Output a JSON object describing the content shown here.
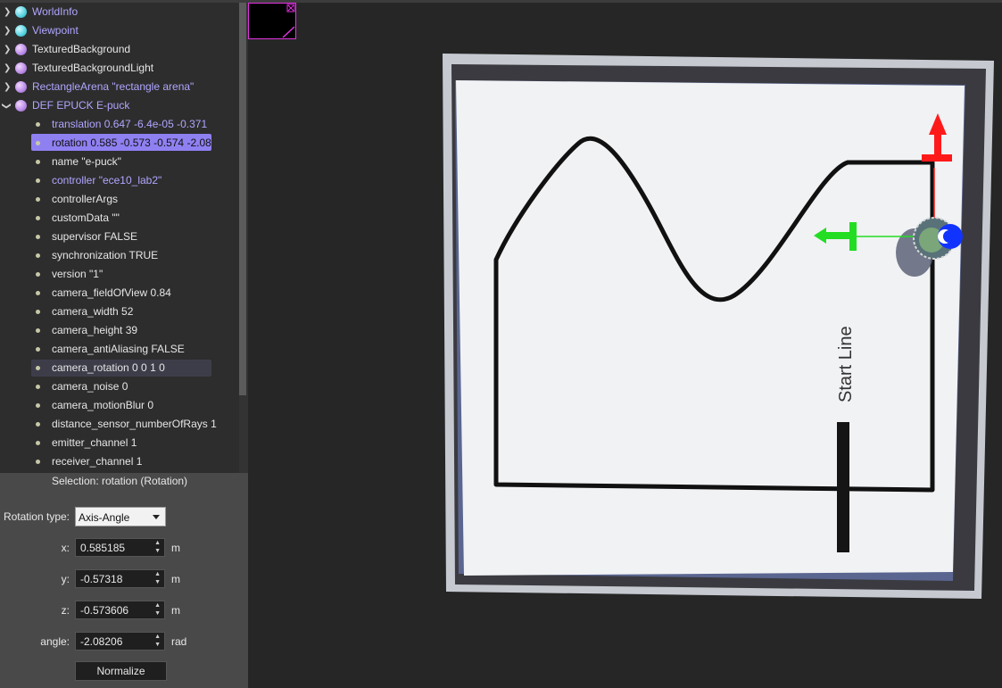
{
  "tree": {
    "top_nodes": [
      {
        "label": "WorldInfo",
        "kind": "cyan"
      },
      {
        "label": "Viewpoint",
        "kind": "cyan"
      },
      {
        "label": "TexturedBackground",
        "kind": "purple"
      },
      {
        "label": "TexturedBackgroundLight",
        "kind": "purple"
      },
      {
        "label": "RectangleArena \"rectangle arena\"",
        "kind": "purple"
      },
      {
        "label": "DEF EPUCK E-puck",
        "kind": "purple"
      }
    ],
    "epuck_fields": [
      "translation 0.647 -6.4e-05 -0.371",
      "rotation 0.585 -0.573 -0.574 -2.08",
      "name \"e-puck\"",
      "controller \"ece10_lab2\"",
      "controllerArgs",
      "customData \"\"",
      "supervisor FALSE",
      "synchronization TRUE",
      "version \"1\"",
      "camera_fieldOfView 0.84",
      "camera_width 52",
      "camera_height 39",
      "camera_antiAliasing FALSE",
      "camera_rotation 0 0 1 0",
      "camera_noise 0",
      "camera_motionBlur 0",
      "distance_sensor_numberOfRays 1",
      "emitter_channel 1",
      "receiver_channel 1"
    ]
  },
  "editor": {
    "selection_title": "Selection: rotation (Rotation)",
    "rotation_type_label": "Rotation type:",
    "rotation_type_value": "Axis-Angle",
    "x_label": "x:",
    "x_value": "0.585185",
    "x_unit": "m",
    "y_label": "y:",
    "y_value": "-0.57318",
    "y_unit": "m",
    "z_label": "z:",
    "z_value": "-0.573606",
    "z_unit": "m",
    "angle_label": "angle:",
    "angle_value": "-2.08206",
    "angle_unit": "rad",
    "normalize_label": "Normalize"
  },
  "scene": {
    "start_line_label": "Start Line"
  },
  "colors": {
    "selection": "#8f80f2",
    "lavender_text": "#b0a6ff",
    "axis_x": "#ff1a1a",
    "axis_y": "#22dd22",
    "axis_z": "#1133ff"
  }
}
